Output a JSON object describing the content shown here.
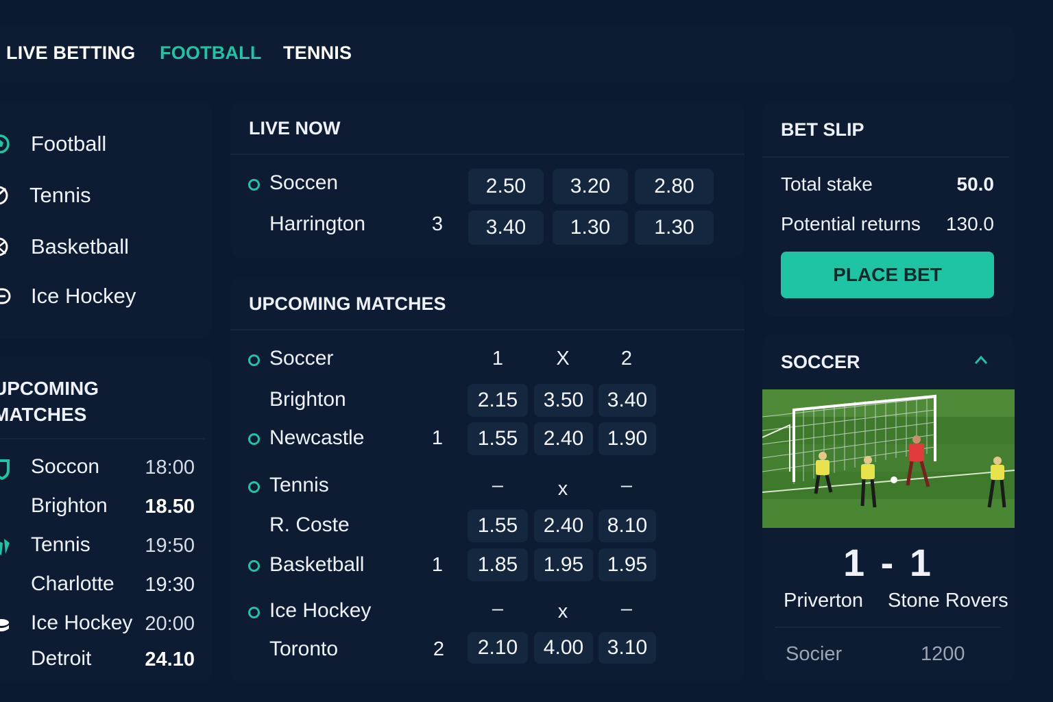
{
  "nav": {
    "tabs": [
      "LIVE BETTING",
      "FOOTBALL",
      "TENNIS"
    ],
    "active_tab": "FOOTBALL"
  },
  "sidebar": {
    "sports": [
      {
        "label": "Football",
        "icon": "football-icon"
      },
      {
        "label": "Tennis",
        "icon": "tennis-ball-icon"
      },
      {
        "label": "Basketball",
        "icon": "basketball-icon"
      },
      {
        "label": "Ice Hockey",
        "icon": "hockey-icon"
      }
    ],
    "upcoming_title_line1": "UPCOMING",
    "upcoming_title_line2": "MATCHES",
    "upcoming": [
      {
        "sport": "Soccon",
        "sport_time": "18:00",
        "team": "Brighton",
        "team_value": "18.50"
      },
      {
        "sport": "Tennis",
        "sport_time": "19:50",
        "team": "Charlotte",
        "team_value": "19:30"
      },
      {
        "sport": "Ice Hockey",
        "sport_time": "20:00",
        "team": "Detroit",
        "team_value": "24.10"
      }
    ]
  },
  "live_now": {
    "title": "LIVE NOW",
    "sport": "Soccen",
    "team": "Harrington",
    "score": "3",
    "odds_row1": [
      "2.50",
      "3.20",
      "2.80"
    ],
    "odds_row2": [
      "3.40",
      "1.30",
      "1.30"
    ]
  },
  "upcoming_matches": {
    "title": "UPCOMING MATCHES",
    "groups": [
      {
        "sport": "Soccer",
        "headers": [
          "1",
          "X",
          "2"
        ],
        "team1": "Brighton",
        "odds1": [
          "2.15",
          "3.50",
          "3.40"
        ],
        "team2": "Newcastle",
        "num2": "1",
        "odds2": [
          "1.55",
          "2.40",
          "1.90"
        ]
      },
      {
        "sport": "Tennis",
        "headers": [
          "–",
          "x",
          "–"
        ],
        "team1": "R. Coste",
        "odds1": [
          "1.55",
          "2.40",
          "8.10"
        ],
        "team2": "Basketball",
        "num2": "1",
        "odds2": [
          "1.85",
          "1.95",
          "1.95"
        ]
      },
      {
        "sport": "Ice Hockey",
        "headers": [
          "–",
          "x",
          "–"
        ],
        "team1": "Toronto",
        "num1": "2",
        "odds1": [
          "2.10",
          "4.00",
          "3.10"
        ]
      }
    ]
  },
  "bet_slip": {
    "title": "BET SLIP",
    "total_stake_label": "Total stake",
    "total_stake_value": "50.0",
    "potential_returns_label": "Potential returns",
    "potential_returns_value": "130.0",
    "place_bet_label": "PLACE BET"
  },
  "live_card": {
    "title": "SOCCER",
    "score": "1 - 1",
    "home_team": "Priverton",
    "away_team": "Stone Rovers",
    "footer_label": "Socier",
    "footer_value": "1200"
  },
  "colors": {
    "accent": "#1ec4a4",
    "background": "#0b1a30",
    "panel": "#0d1c33",
    "odds_cell": "#15263f"
  }
}
